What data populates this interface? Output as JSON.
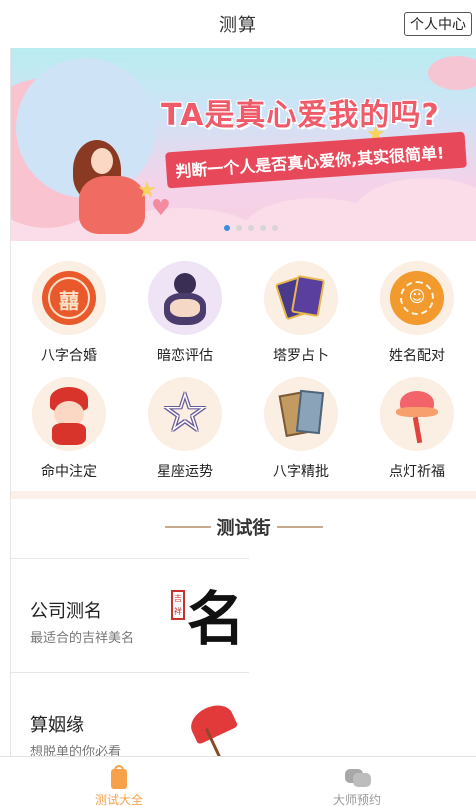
{
  "header": {
    "title": "测算",
    "user_center_label": "个人中心"
  },
  "banner": {
    "headline": "TA是真心爱我的吗?",
    "ribbon_text": "判断一个人是否真心爱你,其实很简单!",
    "slide_count": 5,
    "active_slide": 0
  },
  "grid": {
    "items": [
      {
        "label": "八字合婚",
        "icon": "double-happiness-icon"
      },
      {
        "label": "暗恋评估",
        "icon": "crush-girl-icon"
      },
      {
        "label": "塔罗占卜",
        "icon": "tarot-cards-icon"
      },
      {
        "label": "姓名配对",
        "icon": "name-match-icon"
      },
      {
        "label": "命中注定",
        "icon": "fate-child-icon"
      },
      {
        "label": "星座运势",
        "icon": "star-constellation-icon"
      },
      {
        "label": "八字精批",
        "icon": "scroll-book-icon"
      },
      {
        "label": "点灯祈福",
        "icon": "lotus-lamp-icon"
      }
    ]
  },
  "section": {
    "title": "测试街"
  },
  "list": {
    "items": [
      {
        "title": "公司测名",
        "subtitle": "最适合的吉祥美名",
        "art_char": "名",
        "seal_text": "吉祥"
      },
      {
        "title": "算姻缘",
        "subtitle": "想脱单的你必看",
        "art": "red-umbrella-icon"
      }
    ]
  },
  "tabbar": {
    "tabs": [
      {
        "label": "测试大全",
        "icon": "gift-bag-icon",
        "active": true
      },
      {
        "label": "大师预约",
        "icon": "chat-bubbles-icon",
        "active": false
      }
    ]
  },
  "colors": {
    "accent": "#f7a14a",
    "inactive": "#999999",
    "banner_headline": "#f05b6a",
    "ribbon": "#e8495a"
  }
}
